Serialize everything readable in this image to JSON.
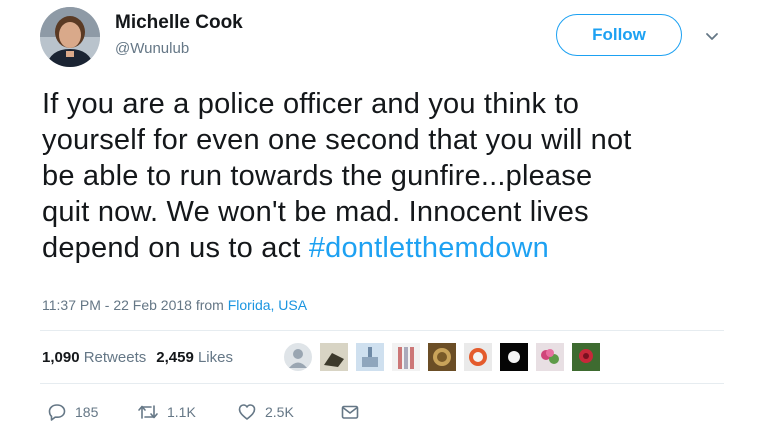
{
  "user": {
    "display_name": "Michelle Cook",
    "handle": "@Wunulub"
  },
  "header": {
    "follow_label": "Follow"
  },
  "tweet": {
    "text_lines": [
      "If you are a police officer and you think to",
      "yourself for even one second that you will not",
      "be able to run towards the gunfire...please",
      "quit now. We won't be mad.  Innocent lives",
      "depend on us to act "
    ],
    "hashtag": "#dontletthemdown",
    "timestamp": "11:37 PM - 22 Feb 2018",
    "from_label": " from ",
    "location": "Florida, USA"
  },
  "stats": {
    "retweets_count": "1,090",
    "retweets_label": " Retweets",
    "likes_count": "2,459",
    "likes_label": " Likes"
  },
  "actions": {
    "replies": "185",
    "retweets": "1.1K",
    "likes": "2.5K"
  },
  "colors": {
    "accent": "#1da1f2",
    "muted": "#657786",
    "text": "#14171a",
    "divider": "#e6ecf0"
  }
}
